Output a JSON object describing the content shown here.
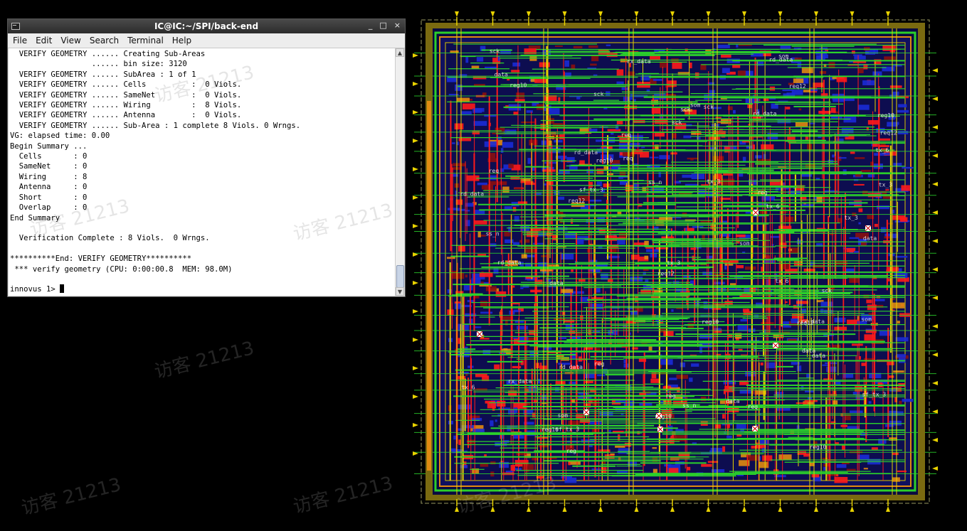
{
  "terminal": {
    "title": "IC@IC:~/SPI/back-end",
    "window_buttons": [
      "_",
      "□",
      "×"
    ],
    "menu": [
      "File",
      "Edit",
      "View",
      "Search",
      "Terminal",
      "Help"
    ],
    "lines": [
      "  VERIFY GEOMETRY ...... Creating Sub-Areas",
      "                  ...... bin size: 3120",
      "  VERIFY GEOMETRY ...... SubArea : 1 of 1",
      "  VERIFY GEOMETRY ...... Cells          :  0 Viols.",
      "  VERIFY GEOMETRY ...... SameNet        :  0 Viols.",
      "  VERIFY GEOMETRY ...... Wiring         :  8 Viols.",
      "  VERIFY GEOMETRY ...... Antenna        :  0 Viols.",
      "  VERIFY GEOMETRY ...... Sub-Area : 1 complete 8 Viols. 0 Wrngs.",
      "VG: elapsed time: 0.00",
      "Begin Summary ...",
      "  Cells       : 0",
      "  SameNet     : 0",
      "  Wiring      : 8",
      "  Antenna     : 0",
      "  Short       : 0",
      "  Overlap     : 0",
      "End Summary",
      "",
      "  Verification Complete : 8 Viols.  0 Wrngs.",
      "",
      "**********End: VERIFY GEOMETRY**********",
      " *** verify geometry (CPU: 0:00:00.8  MEM: 98.0M)",
      ""
    ],
    "prompt": "innovus 1> "
  },
  "layout": {
    "cell_labels": [
      "rx_data",
      "ss_n",
      "req",
      "rd_data",
      "tx_3",
      "sf_tx_3",
      "tx_6",
      "reg",
      "sck",
      "req12",
      "reg10",
      "data",
      "som"
    ],
    "colors": {
      "background": "#000000",
      "metal_h": "#2bd12b",
      "metal_v": "#ff1a1a",
      "metal_blue": "#1a2bd6",
      "metal_yellow": "#e8d200",
      "metal_orange": "#e08a10"
    }
  },
  "watermarks": [
    "访客 21213",
    "访客 21213",
    "访客 21213",
    "访客 21213",
    "访客 21213",
    "访客 21213",
    "访客 21213"
  ]
}
